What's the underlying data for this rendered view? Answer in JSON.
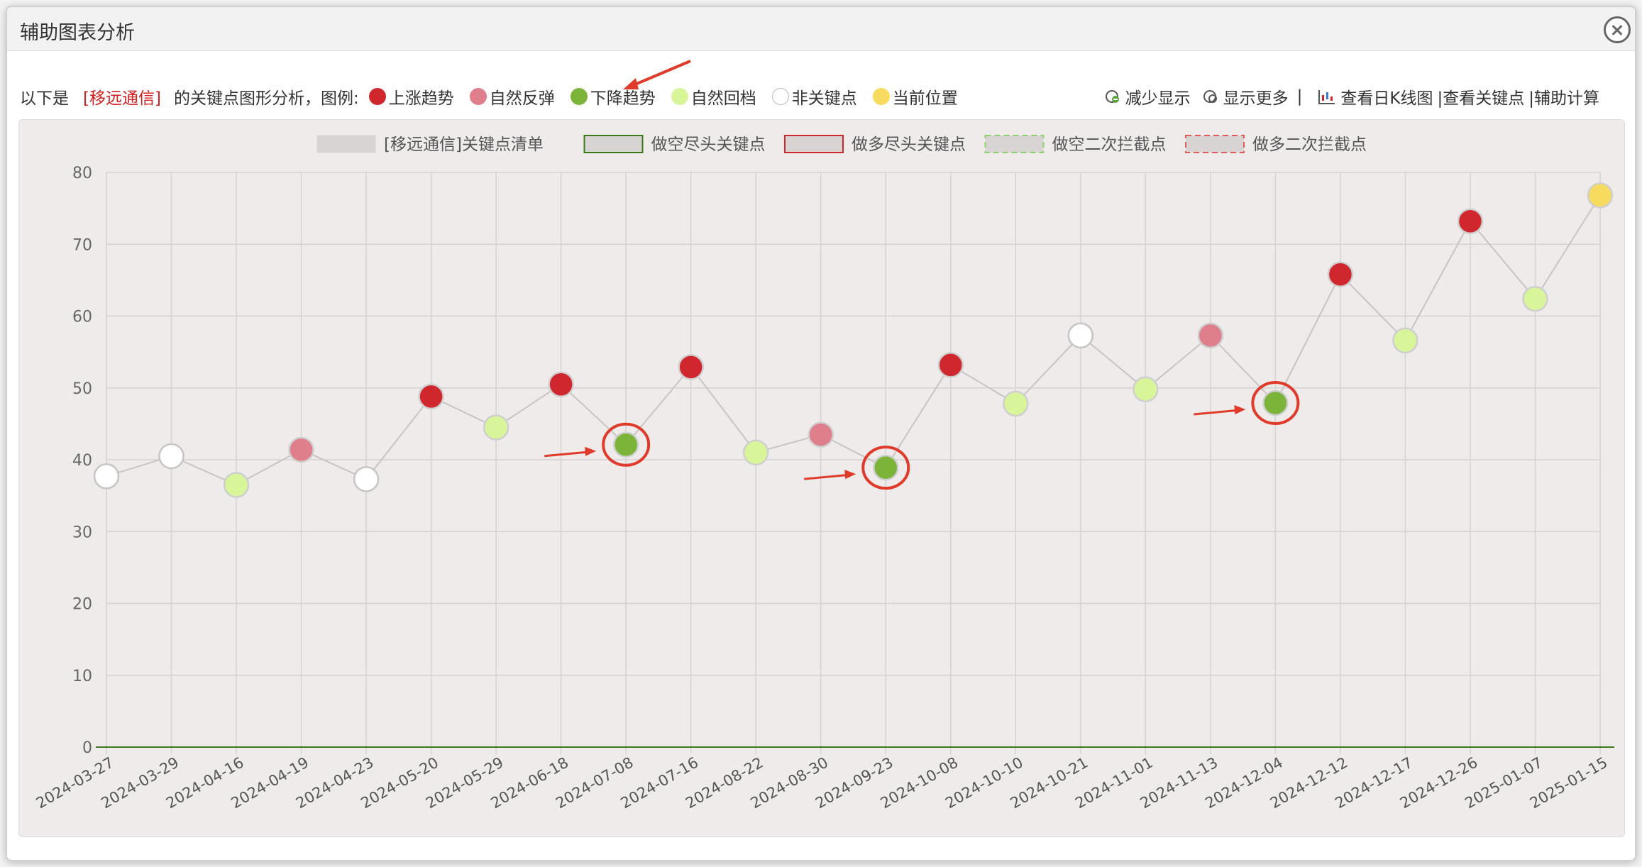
{
  "window": {
    "title": "辅助图表分析"
  },
  "info": {
    "prefix": "以下是",
    "stock": "[移远通信]",
    "suffix": "的关键点图形分析，图例:",
    "legend": [
      {
        "label": "上涨趋势",
        "color": "#d0272e",
        "icon": "red-dot-icon"
      },
      {
        "label": "自然反弹",
        "color": "#e07f8c",
        "icon": "pink-dot-icon"
      },
      {
        "label": "下降趋势",
        "color": "#7cb43a",
        "icon": "green-dot-icon"
      },
      {
        "label": "自然回档",
        "color": "#d8f59a",
        "icon": "light-green-dot-icon"
      },
      {
        "label": "非关键点",
        "color": "#ffffff",
        "icon": "white-dot-icon"
      },
      {
        "label": "当前位置",
        "color": "#f7db5e",
        "icon": "yellow-dot-icon"
      }
    ]
  },
  "tools": {
    "less": "减少显示",
    "more": "显示更多",
    "sep1": "|",
    "kline": "查看日K线图",
    "keypoints": "|查看关键点",
    "calc": "|辅助计算"
  },
  "chart_data": {
    "type": "line",
    "legend": [
      {
        "label": "[移远通信]关键点清单",
        "style": "gray-fill"
      },
      {
        "label": "做空尽头关键点",
        "style": "green-outline"
      },
      {
        "label": "做多尽头关键点",
        "style": "red-outline"
      },
      {
        "label": "做空二次拦截点",
        "style": "green-dashed"
      },
      {
        "label": "做多二次拦截点",
        "style": "red-dashed"
      }
    ],
    "categories": [
      "2024-03-27",
      "2024-03-29",
      "2024-04-16",
      "2024-04-19",
      "2024-04-23",
      "2024-05-20",
      "2024-05-29",
      "2024-06-18",
      "2024-07-08",
      "2024-07-16",
      "2024-08-22",
      "2024-08-30",
      "2024-09-23",
      "2024-10-08",
      "2024-10-10",
      "2024-10-21",
      "2024-11-01",
      "2024-11-13",
      "2024-12-04",
      "2024-12-12",
      "2024-12-17",
      "2024-12-26",
      "2025-01-07",
      "2025-01-15"
    ],
    "values": [
      37.7,
      40.5,
      36.5,
      41.4,
      37.3,
      48.8,
      44.5,
      50.5,
      42.1,
      52.9,
      41.0,
      43.5,
      38.9,
      53.2,
      47.8,
      57.3,
      49.8,
      57.3,
      47.9,
      65.8,
      56.6,
      73.2,
      62.4,
      76.8
    ],
    "point_types": [
      "非关键点",
      "非关键点",
      "自然回档",
      "自然反弹",
      "非关键点",
      "上涨趋势",
      "自然回档",
      "上涨趋势",
      "下降趋势",
      "上涨趋势",
      "自然回档",
      "自然反弹",
      "下降趋势",
      "上涨趋势",
      "自然回档",
      "非关键点",
      "自然回档",
      "自然反弹",
      "下降趋势",
      "上涨趋势",
      "自然回档",
      "上涨趋势",
      "自然回档",
      "当前位置"
    ],
    "type_colors": {
      "上涨趋势": "#d0272e",
      "自然反弹": "#e07f8c",
      "下降趋势": "#7cb43a",
      "自然回档": "#d8f59a",
      "非关键点": "#ffffff",
      "当前位置": "#f7db5e"
    },
    "highlighted": [
      "2024-07-08",
      "2024-09-23",
      "2024-12-04"
    ],
    "y_ticks": [
      0,
      10,
      20,
      30,
      40,
      50,
      60,
      70,
      80
    ],
    "ylim": [
      0,
      80
    ],
    "grid": true,
    "baseline_color": "#3a7a1a"
  }
}
